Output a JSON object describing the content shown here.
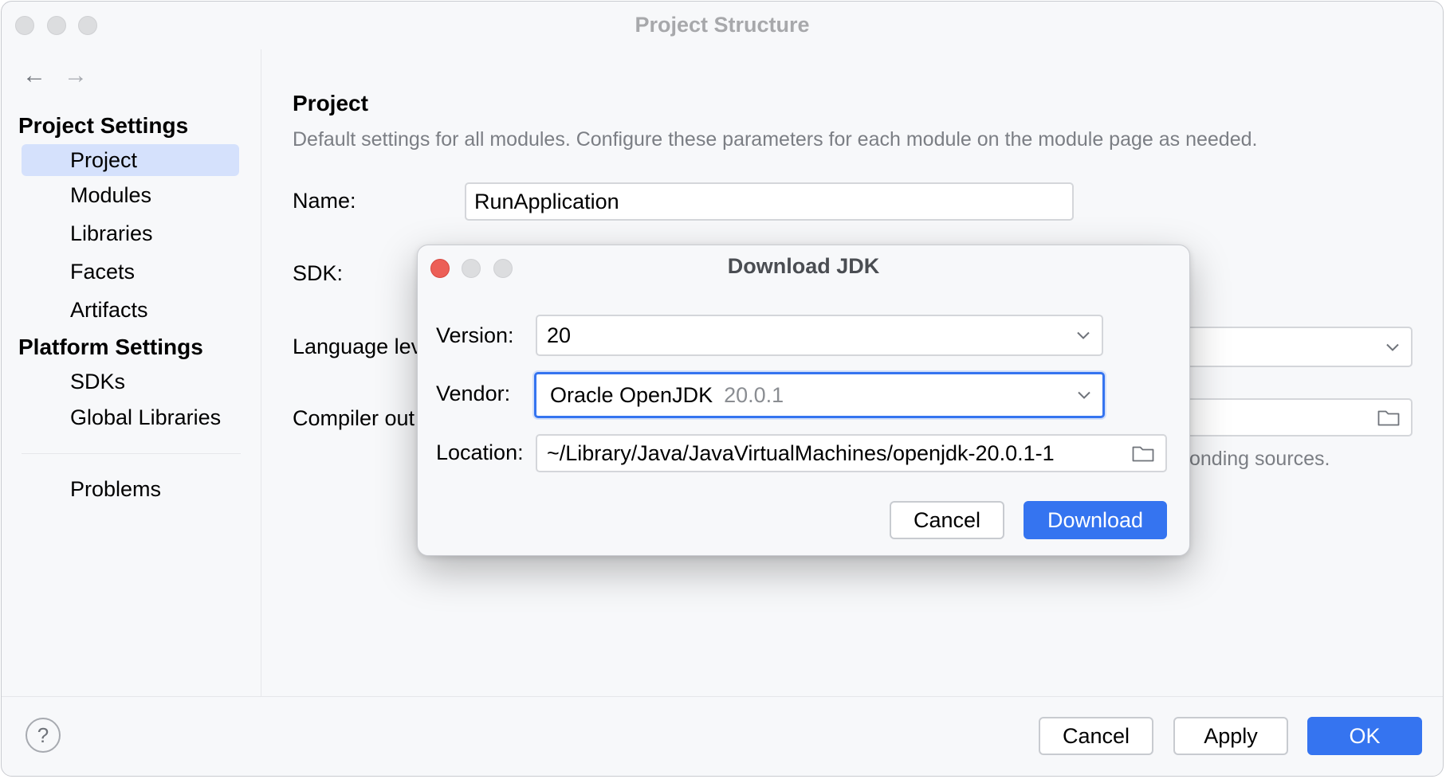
{
  "window": {
    "title": "Project Structure"
  },
  "sidebar": {
    "project_settings_heading": "Project Settings",
    "platform_settings_heading": "Platform Settings",
    "items": [
      {
        "label": "Project"
      },
      {
        "label": "Modules"
      },
      {
        "label": "Libraries"
      },
      {
        "label": "Facets"
      },
      {
        "label": "Artifacts"
      },
      {
        "label": "SDKs"
      },
      {
        "label": "Global Libraries"
      },
      {
        "label": "Problems"
      }
    ],
    "selected": "Project"
  },
  "main": {
    "title": "Project",
    "description": "Default settings for all modules. Configure these parameters for each module on the module page as needed.",
    "name_label": "Name:",
    "name_value": "RunApplication",
    "sdk_label": "SDK:",
    "language_level_label": "Language lev",
    "compiler_output_label": "Compiler out",
    "hint_tail": "onding sources."
  },
  "footer": {
    "help": "?",
    "cancel_label": "Cancel",
    "apply_label": "Apply",
    "ok_label": "OK"
  },
  "dialog": {
    "title": "Download JDK",
    "version_label": "Version:",
    "version_value": "20",
    "vendor_label": "Vendor:",
    "vendor_value": "Oracle OpenJDK",
    "vendor_version": "20.0.1",
    "location_label": "Location:",
    "location_value": "~/Library/Java/JavaVirtualMachines/openjdk-20.0.1-1",
    "cancel_label": "Cancel",
    "download_label": "Download"
  },
  "colors": {
    "accent": "#3574f0",
    "selection": "#d5e1fc",
    "close_light": "#ec5f57"
  }
}
